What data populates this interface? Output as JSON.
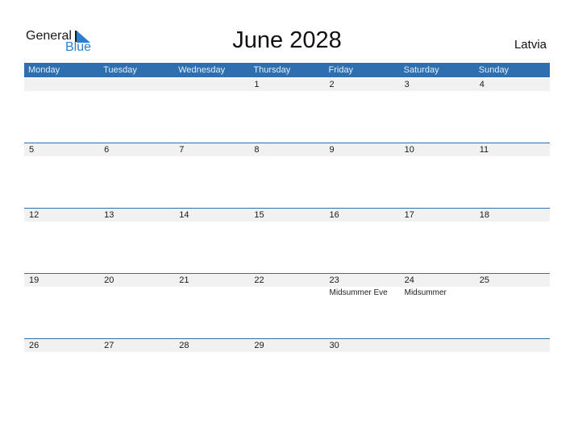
{
  "logo": {
    "line1": "General",
    "line2": "Blue"
  },
  "title": "June 2028",
  "country": "Latvia",
  "colors": {
    "header": "#2e6fb0",
    "band": "#f1f1f1",
    "logo_blue": "#2a7fd0"
  },
  "weekdays": [
    "Monday",
    "Tuesday",
    "Wednesday",
    "Thursday",
    "Friday",
    "Saturday",
    "Sunday"
  ],
  "weeks": [
    {
      "days": [
        {
          "num": "",
          "event": ""
        },
        {
          "num": "",
          "event": ""
        },
        {
          "num": "",
          "event": ""
        },
        {
          "num": "1",
          "event": ""
        },
        {
          "num": "2",
          "event": ""
        },
        {
          "num": "3",
          "event": ""
        },
        {
          "num": "4",
          "event": ""
        }
      ]
    },
    {
      "days": [
        {
          "num": "5",
          "event": ""
        },
        {
          "num": "6",
          "event": ""
        },
        {
          "num": "7",
          "event": ""
        },
        {
          "num": "8",
          "event": ""
        },
        {
          "num": "9",
          "event": ""
        },
        {
          "num": "10",
          "event": ""
        },
        {
          "num": "11",
          "event": ""
        }
      ]
    },
    {
      "days": [
        {
          "num": "12",
          "event": ""
        },
        {
          "num": "13",
          "event": ""
        },
        {
          "num": "14",
          "event": ""
        },
        {
          "num": "15",
          "event": ""
        },
        {
          "num": "16",
          "event": ""
        },
        {
          "num": "17",
          "event": ""
        },
        {
          "num": "18",
          "event": ""
        }
      ]
    },
    {
      "days": [
        {
          "num": "19",
          "event": ""
        },
        {
          "num": "20",
          "event": ""
        },
        {
          "num": "21",
          "event": ""
        },
        {
          "num": "22",
          "event": ""
        },
        {
          "num": "23",
          "event": "Midsummer Eve"
        },
        {
          "num": "24",
          "event": "Midsummer"
        },
        {
          "num": "25",
          "event": ""
        }
      ]
    },
    {
      "days": [
        {
          "num": "26",
          "event": ""
        },
        {
          "num": "27",
          "event": ""
        },
        {
          "num": "28",
          "event": ""
        },
        {
          "num": "29",
          "event": ""
        },
        {
          "num": "30",
          "event": ""
        },
        {
          "num": "",
          "event": ""
        },
        {
          "num": "",
          "event": ""
        }
      ]
    }
  ]
}
